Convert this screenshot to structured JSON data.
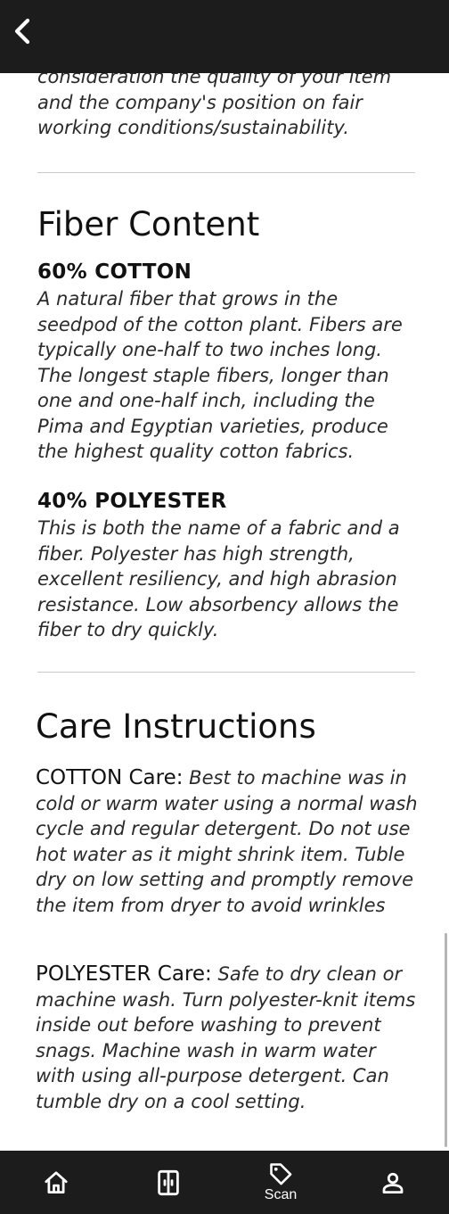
{
  "header": {
    "back_icon": "chevron-left-icon"
  },
  "intro": {
    "text": "consideration the quality of your item and the company's position on fair working conditions/sustainability."
  },
  "fiber_content": {
    "title": "Fiber Content",
    "items": [
      {
        "name": "60% COTTON",
        "description": "A natural fiber that grows in the seedpod of the cotton plant. Fibers are typically one-half to two inches long. The longest staple fibers, longer than one and one-half inch, including the Pima and Egyptian varieties, produce the highest quality cotton fabrics."
      },
      {
        "name": "40% POLYESTER",
        "description": "This is both the name of a fabric and a fiber. Polyester has high strength, excellent resiliency, and high abrasion resistance. Low absorbency allows the fiber to dry quickly."
      }
    ]
  },
  "care_instructions": {
    "title": "Care Instructions",
    "items": [
      {
        "label": "COTTON Care:",
        "text": "Best to machine was in cold or warm water using a normal wash cycle and regular detergent. Do not use hot water as it might shrink item. Tuble dry on low setting and promptly remove the item from dryer to avoid wrinkles"
      },
      {
        "label": "POLYESTER Care:",
        "text": "Safe to dry clean or machine wash. Turn polyester-knit items inside out before washing to prevent snags. Machine wash in warm water with using all-purpose detergent. Can tumble dry on a cool setting."
      }
    ]
  },
  "bottom_nav": {
    "items": [
      {
        "icon": "home-icon",
        "label": ""
      },
      {
        "icon": "closet-icon",
        "label": ""
      },
      {
        "icon": "tag-icon",
        "label": "Scan"
      },
      {
        "icon": "person-icon",
        "label": ""
      }
    ]
  },
  "colors": {
    "bar_background": "#1c1c1c",
    "page_background": "#ffffff",
    "icon_color": "#ffffff"
  }
}
